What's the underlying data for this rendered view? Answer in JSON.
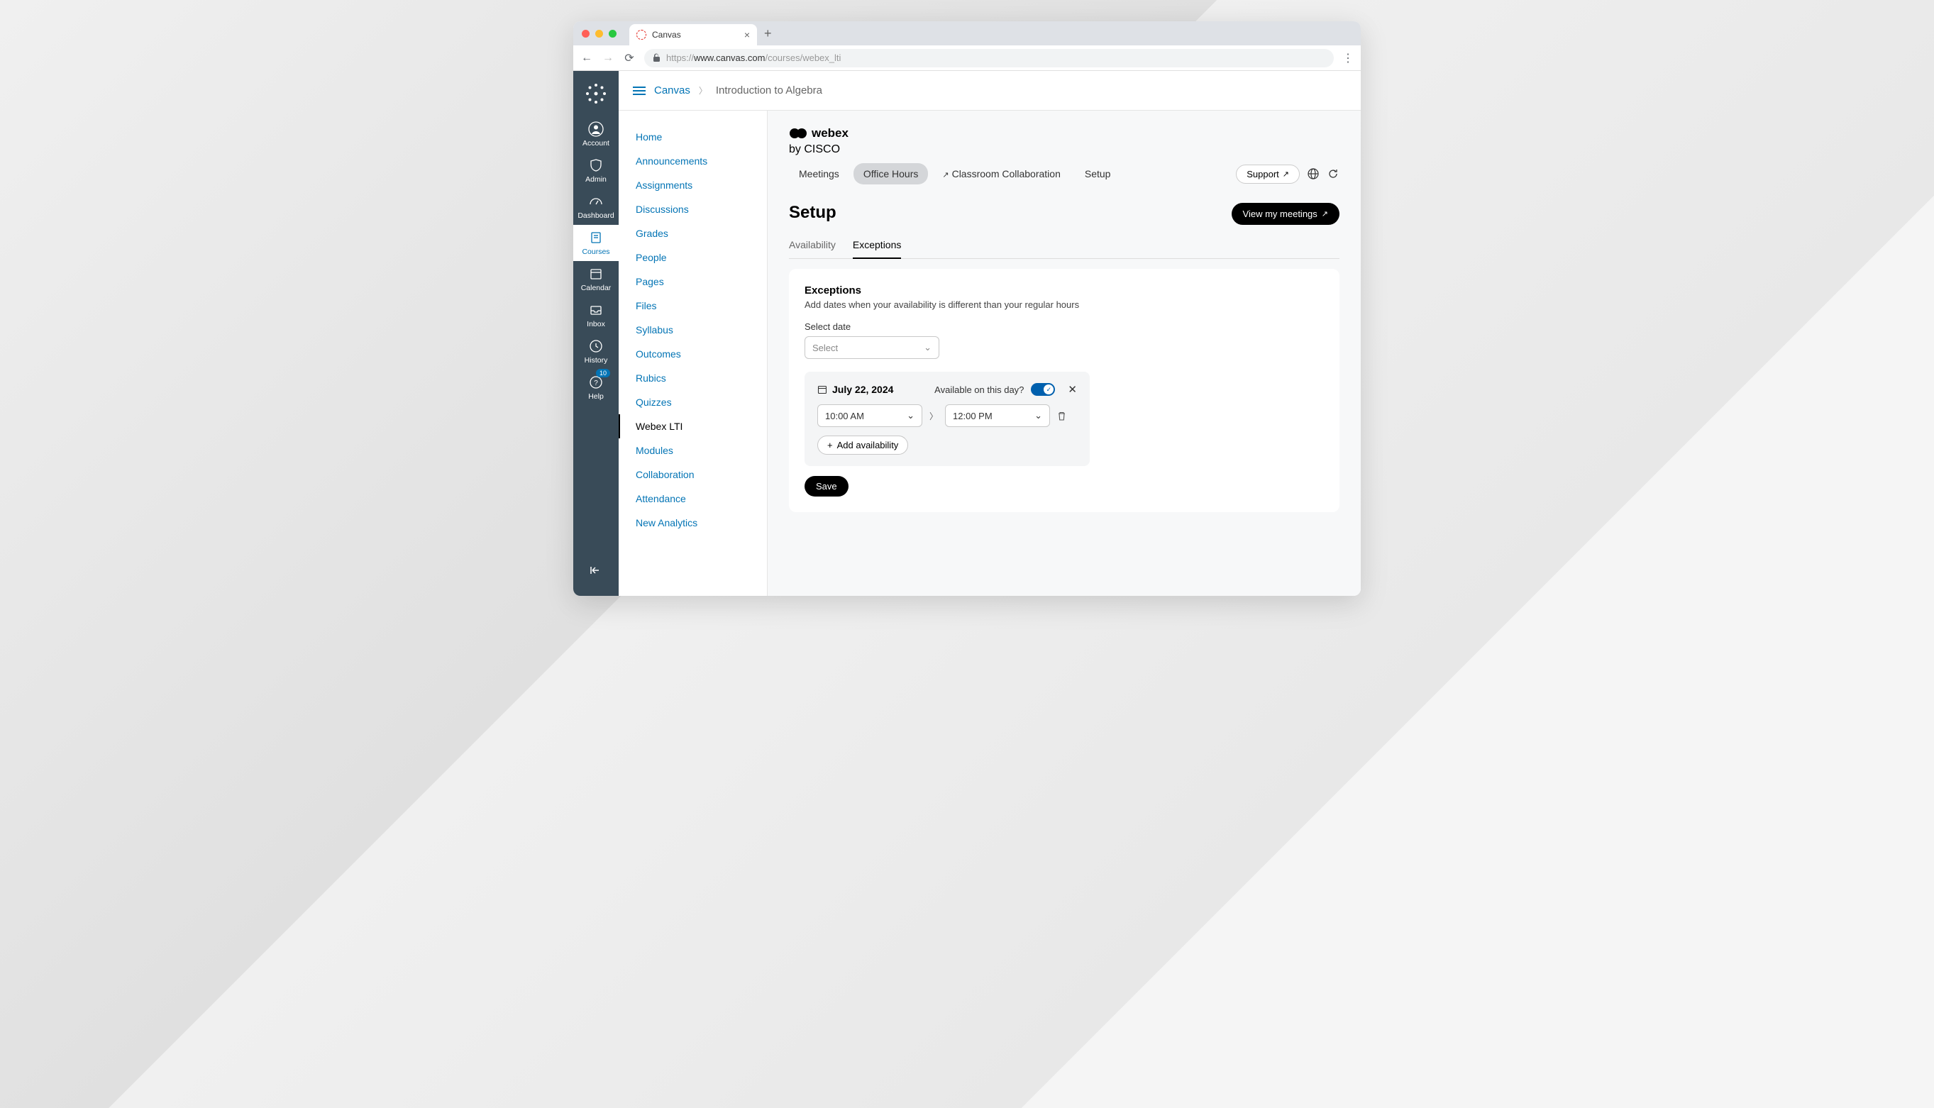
{
  "browser": {
    "tab_title": "Canvas",
    "url_pre": "https://",
    "url_mid": "www.canvas.com",
    "url_post": "/courses/webex_lti"
  },
  "sidebar": {
    "items": [
      {
        "label": "Account"
      },
      {
        "label": "Admin"
      },
      {
        "label": "Dashboard"
      },
      {
        "label": "Courses"
      },
      {
        "label": "Calendar"
      },
      {
        "label": "Inbox"
      },
      {
        "label": "History"
      },
      {
        "label": "Help"
      }
    ],
    "help_badge": "10"
  },
  "breadcrumb": {
    "root": "Canvas",
    "current": "Introduction to Algebra"
  },
  "course_nav": {
    "items": [
      "Home",
      "Announcements",
      "Assignments",
      "Discussions",
      "Grades",
      "People",
      "Pages",
      "Files",
      "Syllabus",
      "Outcomes",
      "Rubics",
      "Quizzes",
      "Webex LTI",
      "Modules",
      "Collaboration",
      "Attendance",
      "New Analytics"
    ],
    "active": "Webex LTI"
  },
  "webex": {
    "brand": "webex",
    "brand_sub": "by CISCO",
    "tabs": {
      "meetings": "Meetings",
      "office_hours": "Office Hours",
      "classroom": "Classroom Collaboration",
      "setup": "Setup"
    },
    "support": "Support",
    "setup_title": "Setup",
    "view_meetings": "View my meetings",
    "subtabs": {
      "availability": "Availability",
      "exceptions": "Exceptions"
    },
    "card": {
      "heading": "Exceptions",
      "desc": "Add dates when your availability is different than your regular hours",
      "select_date_label": "Select date",
      "select_placeholder": "Select",
      "exception": {
        "date": "July 22, 2024",
        "available_label": "Available on this day?",
        "start": "10:00 AM",
        "end": "12:00 PM",
        "add_availability": "Add availability"
      },
      "save": "Save"
    }
  }
}
